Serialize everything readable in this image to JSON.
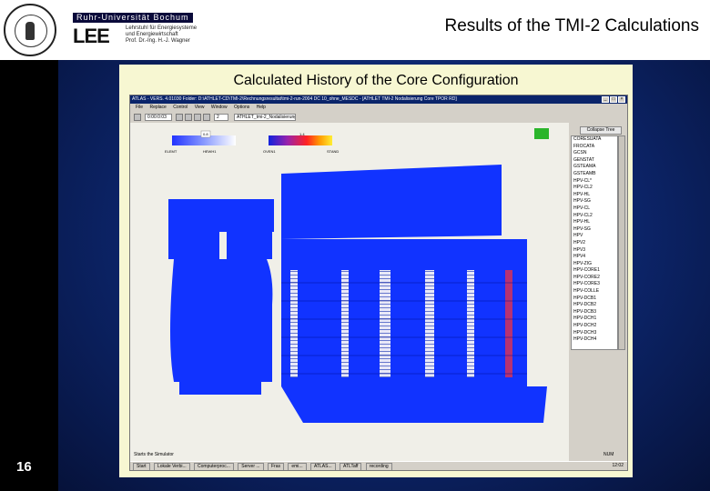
{
  "header": {
    "university_name": "Ruhr-Universität Bochum",
    "institute_abbr": "LEE",
    "institute_lines": [
      "Lehrstuhl für Energiesysteme",
      "und Energiewirtschaft",
      "Prof. Dr.-Ing. H.-J. Wagner"
    ],
    "slide_title": "Results of the TMI-2 Calculations"
  },
  "slide_number": "16",
  "panel": {
    "title": "Calculated History of the Core Configuration",
    "background_color": "#f7f7d2"
  },
  "app": {
    "window_title": "ATLAS - VERS. 4.01030   Folder: D:\\ATHLET-CD\\TMI-2\\Rechnungsresultat\\tmi-2-run-2004 DC 10_ohne_MESDC - [ATHLET TMI-2 Nodalisierung Core TPOR RD]",
    "menu": [
      "File",
      "Replace",
      "Control",
      "View",
      "Window",
      "Options",
      "Help"
    ],
    "time_field": "0:00:0:03",
    "zoom_value": "2",
    "view_select": "ATHLET_tmi-2_Nodalisierung_C",
    "colorbar_left": {
      "value": "0.8",
      "labels": [
        "ELEMT",
        "HEWH1"
      ]
    },
    "colorbar_right": {
      "value": "1.4",
      "labels": [
        "OVEN1",
        "STAND"
      ]
    },
    "collapse_button": "Collapse Tree",
    "tree_items": [
      "CORESUATA",
      "FROCATA",
      "GCSN",
      "GENSTAT",
      "GSTEAMA",
      "GSTEAMB",
      "HPV-CL*",
      "HPV-CL2",
      "HPV-HL",
      "HPV-SG",
      "HPV-CL",
      "HPV-CL2",
      "HPV-HL",
      "HPV-SG",
      "HPV",
      "HPV2",
      "HPV3",
      "HPV4",
      "HPV-ZIG",
      "HPV-CORE1",
      "HPV-CORE2",
      "HPV-CORE3",
      "HPV-COLLE",
      "HPV-DCB1",
      "HPV-DCB2",
      "HPV-DCB3",
      "HPV-DCH1",
      "HPV-DCH2",
      "HPV-DCH3",
      "HPV-DCH4"
    ],
    "status_text": "Starts the Simulator",
    "status_right": "NUM",
    "taskbar": [
      "Start",
      "Lokale Verbi...",
      "",
      "Computerproc...",
      "Server ...",
      "Fras",
      "emi...",
      "ATLAS...",
      "ATLTaff",
      "recording"
    ],
    "clock": "12:02",
    "colors": {
      "coolant_blue": "#1133ff",
      "titlebar": "#0a246a",
      "status_green": "#2bb52b",
      "rod_red": "#ee3344"
    }
  }
}
